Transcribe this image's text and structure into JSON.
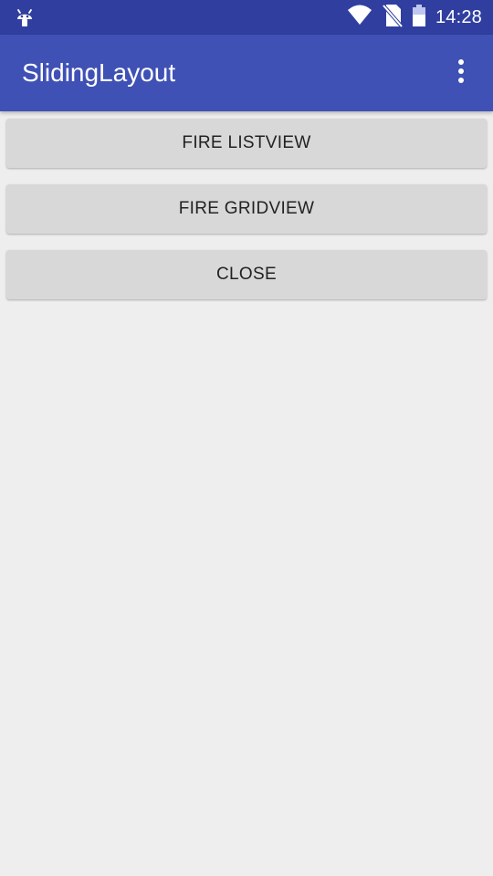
{
  "status_bar": {
    "time": "14:28",
    "icons": [
      "android-debug-icon",
      "wifi-icon",
      "no-sim-icon",
      "battery-icon"
    ],
    "color": "#303f9f"
  },
  "app_bar": {
    "title": "SlidingLayout",
    "color": "#3f51b5",
    "menu_icon": "overflow-menu-icon"
  },
  "buttons": [
    {
      "label": "FIRE LISTVIEW"
    },
    {
      "label": "FIRE GRIDVIEW"
    },
    {
      "label": "CLOSE"
    }
  ],
  "colors": {
    "background": "#eeeeee",
    "button": "#d8d8d8",
    "button_text": "#222222"
  }
}
